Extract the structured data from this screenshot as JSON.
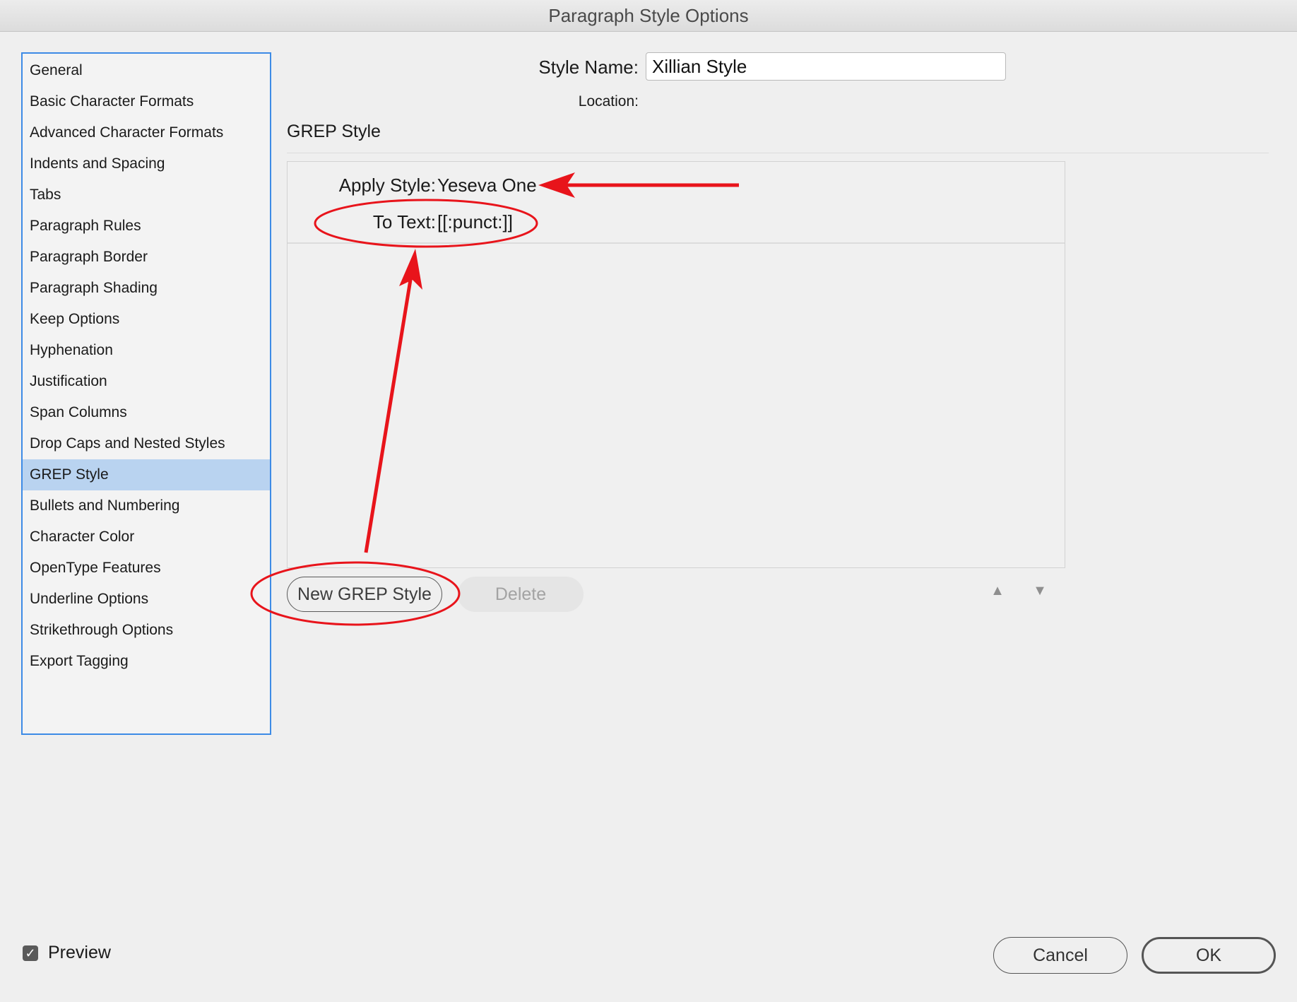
{
  "window": {
    "title": "Paragraph Style Options"
  },
  "sidebar": {
    "items": [
      {
        "label": "General"
      },
      {
        "label": "Basic Character Formats"
      },
      {
        "label": "Advanced Character Formats"
      },
      {
        "label": "Indents and Spacing"
      },
      {
        "label": "Tabs"
      },
      {
        "label": "Paragraph Rules"
      },
      {
        "label": "Paragraph Border"
      },
      {
        "label": "Paragraph Shading"
      },
      {
        "label": "Keep Options"
      },
      {
        "label": "Hyphenation"
      },
      {
        "label": "Justification"
      },
      {
        "label": "Span Columns"
      },
      {
        "label": "Drop Caps and Nested Styles"
      },
      {
        "label": "GREP Style"
      },
      {
        "label": "Bullets and Numbering"
      },
      {
        "label": "Character Color"
      },
      {
        "label": "OpenType Features"
      },
      {
        "label": "Underline Options"
      },
      {
        "label": "Strikethrough Options"
      },
      {
        "label": "Export Tagging"
      }
    ],
    "selected": "GREP Style"
  },
  "header": {
    "style_name_label": "Style Name:",
    "style_name_value": "Xillian Style",
    "location_label": "Location:"
  },
  "section": {
    "title": "GREP Style"
  },
  "grep_styles": [
    {
      "apply_style_label": "Apply Style:",
      "apply_style_value": "Yeseva One",
      "to_text_label": "To Text:",
      "to_text_value": "[[:punct:]]"
    }
  ],
  "buttons": {
    "new_grep": "New GREP Style",
    "delete": "Delete",
    "cancel": "Cancel",
    "ok": "OK"
  },
  "reorder": {
    "up_icon": "▲",
    "down_icon": "▼"
  },
  "preview": {
    "label": "Preview",
    "checked": true,
    "check_glyph": "✓"
  },
  "colors": {
    "accent": "#3d8be6",
    "selection": "#b9d3f0",
    "annotation": "#e8141b"
  }
}
